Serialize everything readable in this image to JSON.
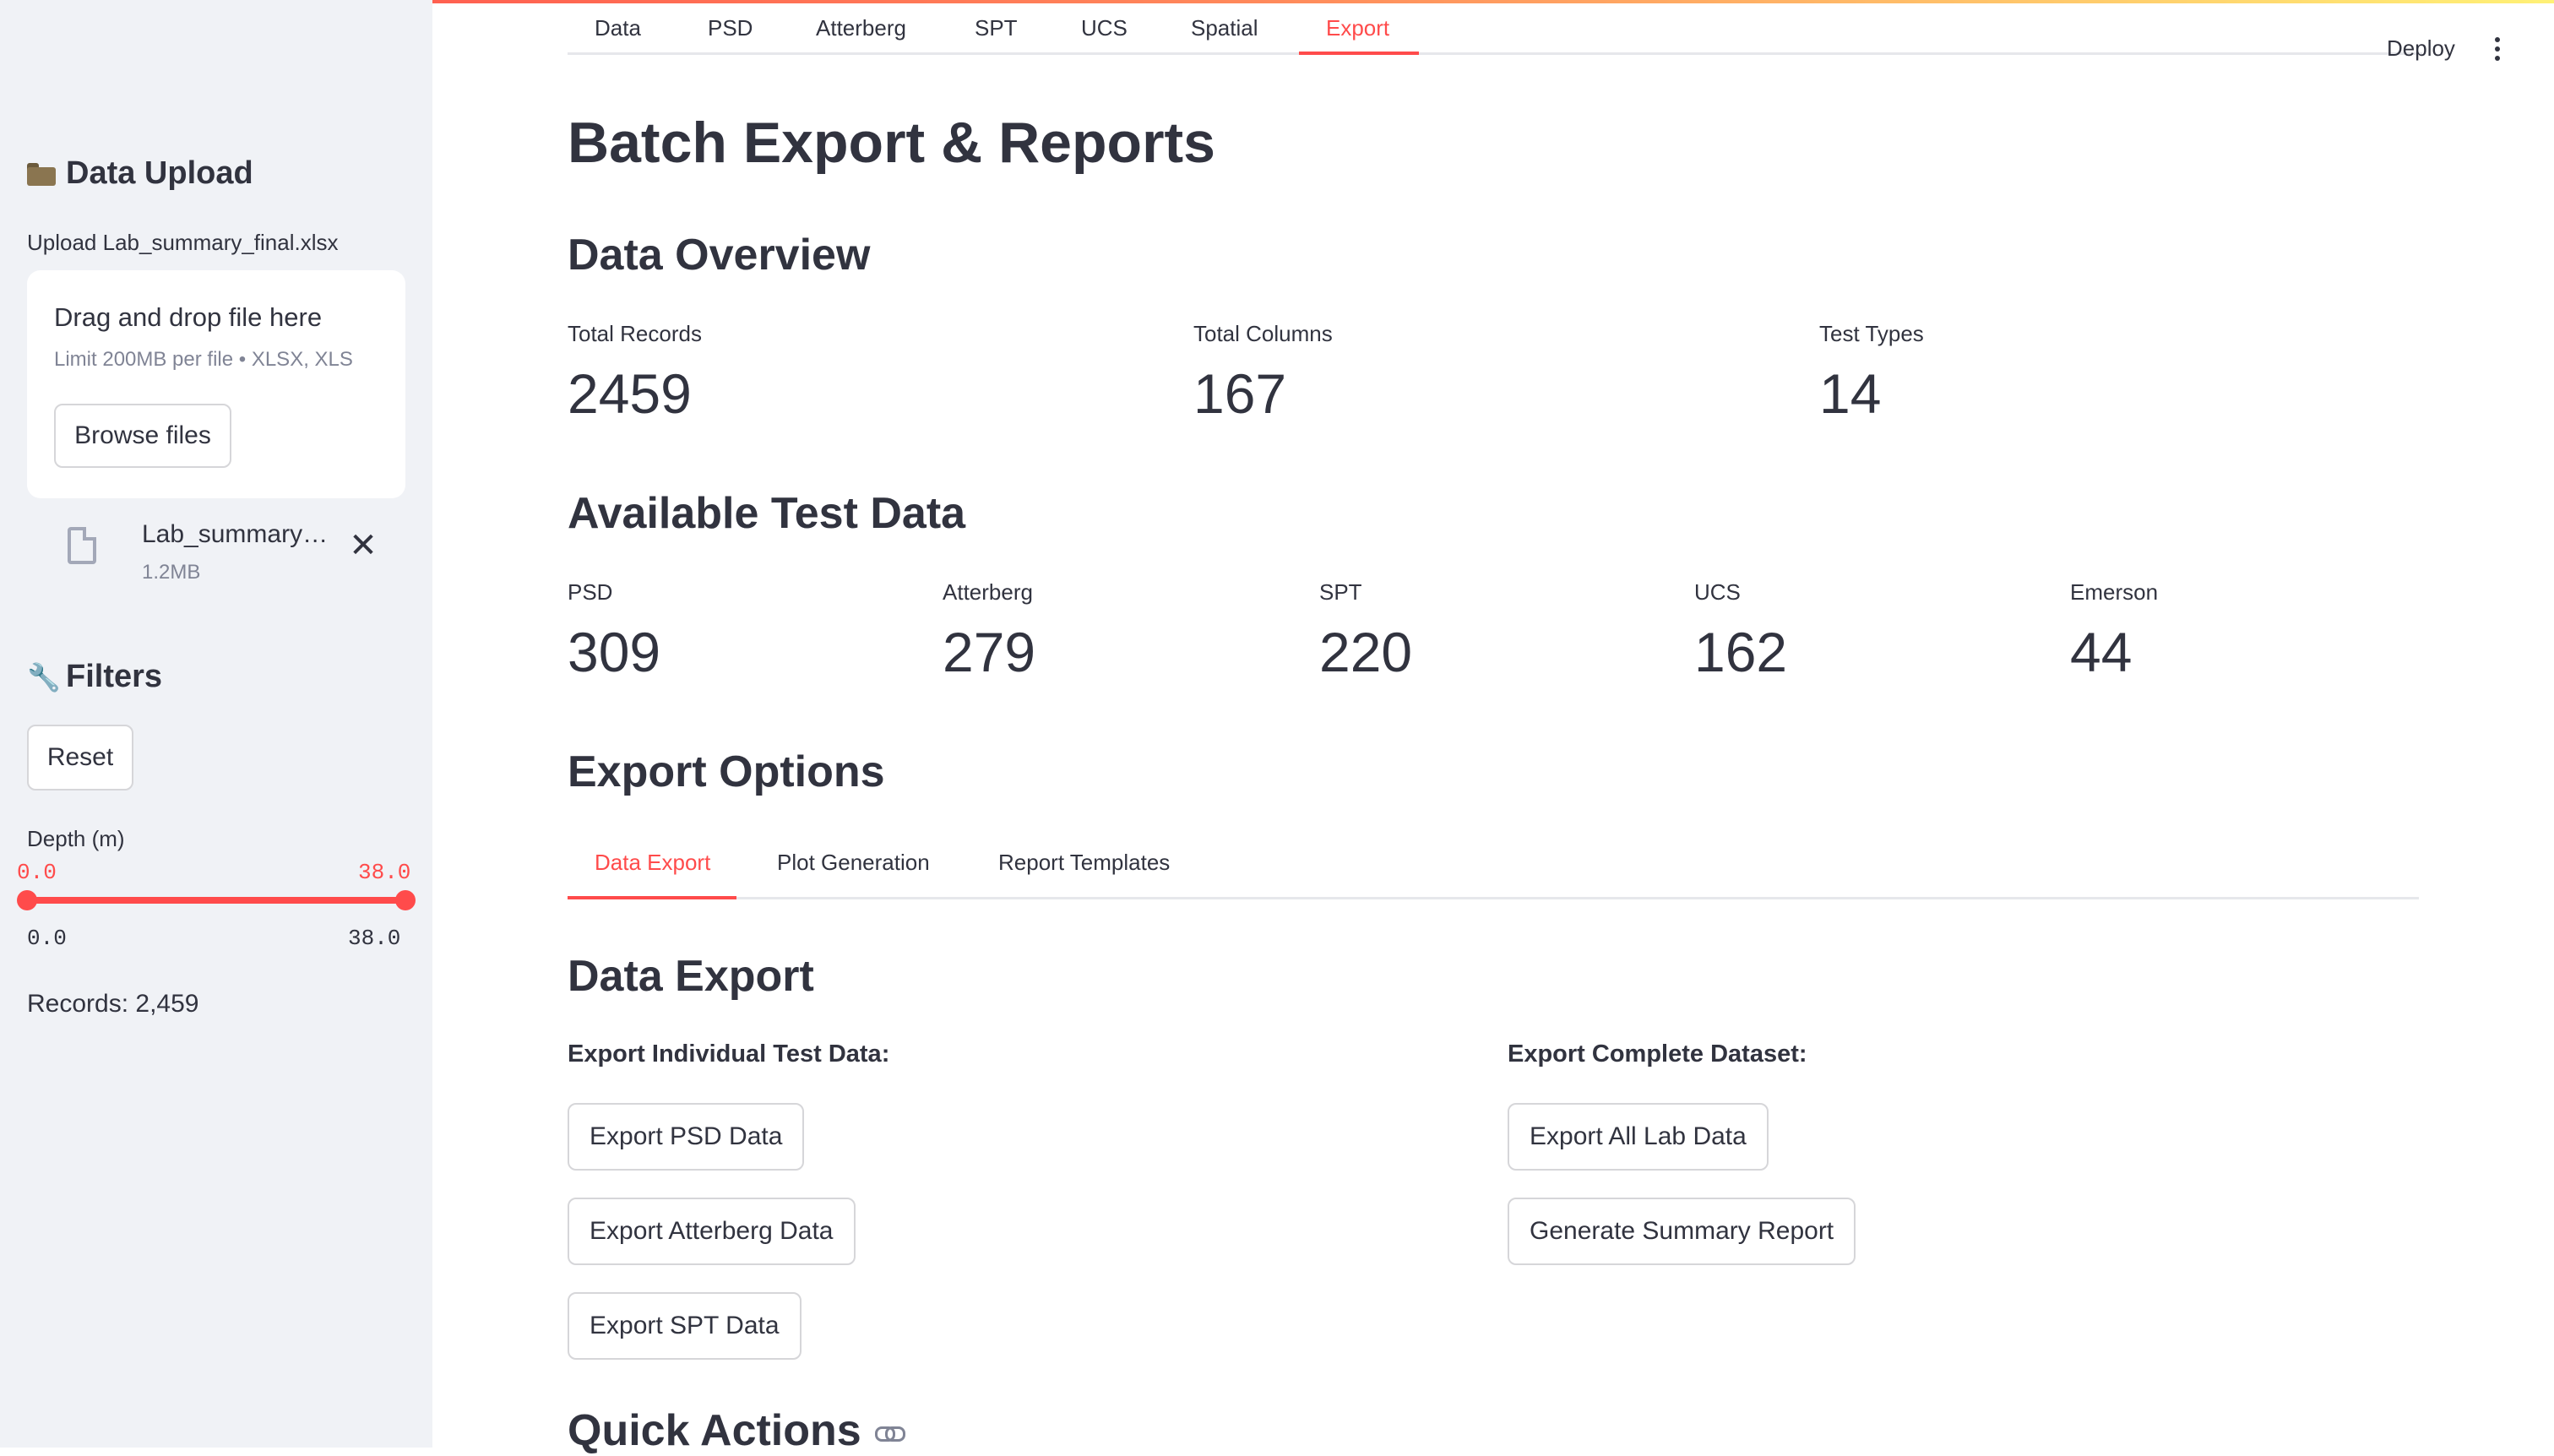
{
  "sidebar": {
    "upload_header": "Data Upload",
    "upload_label": "Upload Lab_summary_final.xlsx",
    "dropzone_title": "Drag and drop file here",
    "dropzone_limit": "Limit 200MB per file • XLSX, XLS",
    "browse_label": "Browse files",
    "file_name": "Lab_summary…",
    "file_size": "1.2MB",
    "filters_header": "Filters",
    "reset_label": "Reset",
    "depth_label": "Depth (m)",
    "depth_min": "0.0",
    "depth_max": "38.0",
    "depth_range_fraction": [
      0.0,
      1.0
    ],
    "records": "Records: 2,459"
  },
  "top_tabs": [
    "Data",
    "PSD",
    "Atterberg",
    "SPT",
    "UCS",
    "Spatial",
    "Export"
  ],
  "active_top_tab": "Export",
  "header": {
    "deploy_label": "Deploy",
    "menu_icon": "kebab-icon"
  },
  "main": {
    "title": "Batch Export & Reports",
    "overview_header": "Data Overview",
    "overview": [
      {
        "label": "Total Records",
        "value": "2459"
      },
      {
        "label": "Total Columns",
        "value": "167"
      },
      {
        "label": "Test Types",
        "value": "14"
      }
    ],
    "available_header": "Available Test Data",
    "available": [
      {
        "label": "PSD",
        "value": "309"
      },
      {
        "label": "Atterberg",
        "value": "279"
      },
      {
        "label": "SPT",
        "value": "220"
      },
      {
        "label": "UCS",
        "value": "162"
      },
      {
        "label": "Emerson",
        "value": "44"
      }
    ],
    "export_options_header": "Export Options",
    "sub_tabs": [
      "Data Export",
      "Plot Generation",
      "Report Templates"
    ],
    "active_sub_tab": "Data Export",
    "data_export_header": "Data Export",
    "individual_label": "Export Individual Test Data:",
    "individual_buttons": [
      "Export PSD Data",
      "Export Atterberg Data",
      "Export SPT Data"
    ],
    "complete_label": "Export Complete Dataset:",
    "complete_buttons": [
      "Export All Lab Data",
      "Generate Summary Report"
    ],
    "quick_actions_header": "Quick Actions"
  },
  "colors": {
    "accent": "#ff4b4b",
    "sidebar_bg": "#f0f2f6",
    "text": "#31333f"
  }
}
